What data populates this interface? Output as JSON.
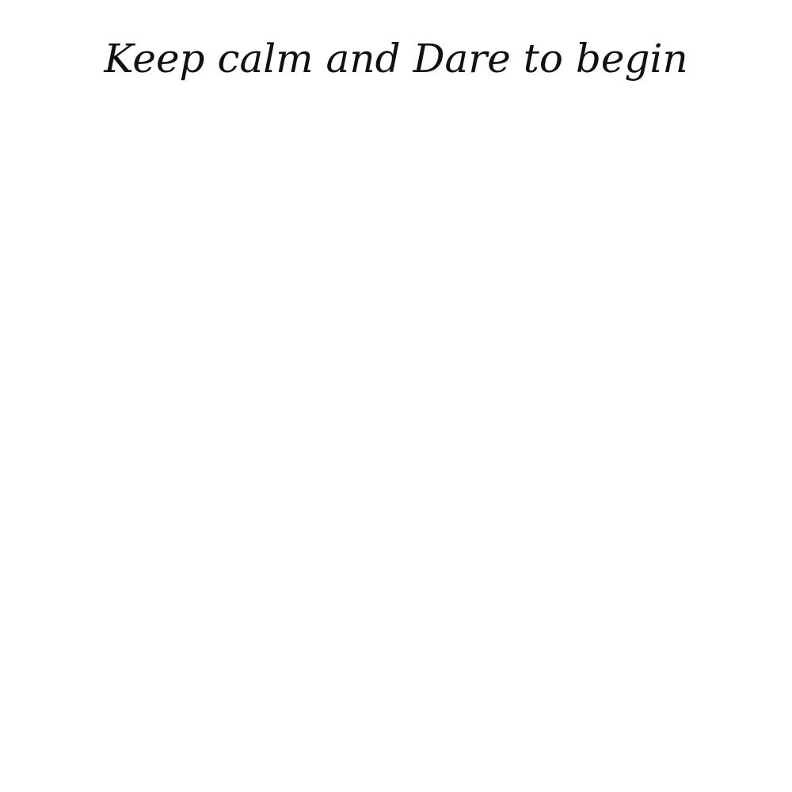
{
  "headline": {
    "text": "Keep calm and Dare to begin",
    "color": "#111111"
  },
  "background_color": "#ffffff"
}
